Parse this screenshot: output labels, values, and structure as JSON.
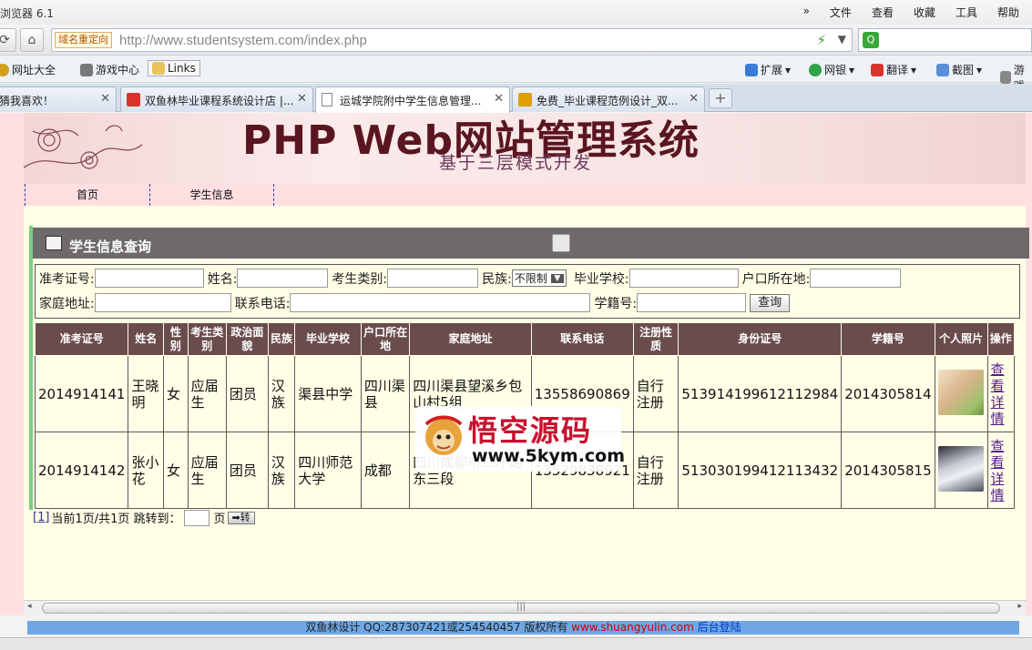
{
  "browser": {
    "title": "浏览器 6.1",
    "menu": [
      "文件",
      "查看",
      "收藏",
      "工具",
      "帮助"
    ],
    "redirect_label": "域名重定向",
    "url_host": "http://www.studentsystem.com",
    "url_path": "/index.php",
    "favorites": [
      "网址大全",
      "游戏中心",
      "Links"
    ],
    "right_tools": [
      "扩展",
      "网银",
      "翻译",
      "截图",
      "游戏"
    ],
    "tabs": [
      {
        "label": "猜我喜欢！",
        "active": false
      },
      {
        "label": "双鱼林毕业课程系统设计店 |...",
        "active": false
      },
      {
        "label": "运城学院附中学生信息管理...",
        "active": true
      },
      {
        "label": "免费_毕业课程范例设计_双...",
        "active": false
      }
    ],
    "new_tab": "+"
  },
  "banner": {
    "title": "PHP Web网站管理系统",
    "subtitle": "基于三层模式开发"
  },
  "nav": {
    "items": [
      "首页",
      "学生信息"
    ]
  },
  "panel": {
    "title": "学生信息查询"
  },
  "search_form": {
    "labels": {
      "exam_no": "准考证号:",
      "name": "姓名:",
      "category": "考生类别:",
      "ethnicity": "民族:",
      "school": "毕业学校:",
      "hukou": "户口所在地:",
      "address": "家庭地址:",
      "phone": "联系电话:",
      "reg_no": "学籍号:"
    },
    "ethnicity_selected": "不限制",
    "query_button": "查询"
  },
  "table": {
    "headers": [
      "准考证号",
      "姓名",
      "性别",
      "考生类别",
      "政治面貌",
      "民族",
      "毕业学校",
      "户口所在地",
      "家庭地址",
      "联系电话",
      "注册性质",
      "身份证号",
      "学籍号",
      "个人照片",
      "操作"
    ],
    "rows": [
      {
        "exam_no": "2014914141",
        "name": "王晓明",
        "gender": "女",
        "category": "应届生",
        "politics": "团员",
        "ethnicity": "汉族",
        "school": "渠县中学",
        "hukou": "四川渠县",
        "address": "四川渠县望溪乡包山村5组",
        "phone": "13558690869",
        "reg_type": "自行注册",
        "id_no": "513914199612112984",
        "reg_no": "2014305814",
        "action": "查看详情"
      },
      {
        "exam_no": "2014914142",
        "name": "张小花",
        "gender": "女",
        "category": "应届生",
        "politics": "团员",
        "ethnicity": "汉族",
        "school": "四川师范大学",
        "hukou": "成都",
        "address": "四川成都市二环路东三段",
        "phone": "13529838921",
        "reg_type": "自行注册",
        "id_no": "513030199412113432",
        "reg_no": "2014305815",
        "action": "查看详情"
      }
    ]
  },
  "pager": {
    "page_link": "[1]",
    "info": "当前1页/共1页 跳转到：",
    "page_unit": "页",
    "go_button": "➡转"
  },
  "footer": {
    "text1": "双鱼林设计 QQ:287307421或254540457  版权所有",
    "link": "www.shuangyulin.com",
    "admin": "后台登陆"
  },
  "watermark": {
    "cn": "悟空源码",
    "url": "www.5kym.com"
  },
  "colors": {
    "page_bg": "#fffee6",
    "header_bg": "#6b4c4c",
    "panel_head": "#6e6a6a",
    "accent_green": "#7bd07b",
    "footer_bg": "#6fa7e3"
  }
}
